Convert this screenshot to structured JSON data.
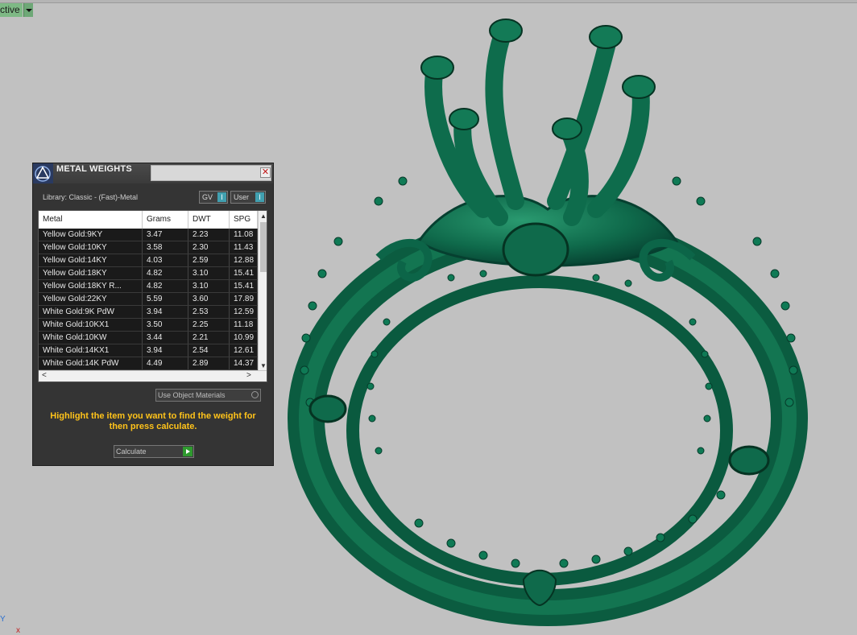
{
  "viewport": {
    "label": "ctive",
    "background": "#c1c1c1",
    "model_color": "#0f6a4b"
  },
  "dialog": {
    "title": "METAL WEIGHTS",
    "library": "Library: Classic - (Fast)-Metal",
    "toggle_gv": "GV",
    "toggle_user": "User",
    "toggle_indicator": "I",
    "columns": [
      "Metal",
      "Grams",
      "DWT",
      "SPG"
    ],
    "rows": [
      {
        "metal": "Yellow Gold:9KY",
        "grams": "3.47",
        "dwt": "2.23",
        "spg": "11.08"
      },
      {
        "metal": "Yellow Gold:10KY",
        "grams": "3.58",
        "dwt": "2.30",
        "spg": "11.43"
      },
      {
        "metal": "Yellow Gold:14KY",
        "grams": "4.03",
        "dwt": "2.59",
        "spg": "12.88"
      },
      {
        "metal": "Yellow Gold:18KY",
        "grams": "4.82",
        "dwt": "3.10",
        "spg": "15.41"
      },
      {
        "metal": "Yellow Gold:18KY R...",
        "grams": "4.82",
        "dwt": "3.10",
        "spg": "15.41"
      },
      {
        "metal": "Yellow Gold:22KY",
        "grams": "5.59",
        "dwt": "3.60",
        "spg": "17.89"
      },
      {
        "metal": "White Gold:9K PdW",
        "grams": "3.94",
        "dwt": "2.53",
        "spg": "12.59"
      },
      {
        "metal": "White Gold:10KX1",
        "grams": "3.50",
        "dwt": "2.25",
        "spg": "11.18"
      },
      {
        "metal": "White Gold:10KW",
        "grams": "3.44",
        "dwt": "2.21",
        "spg": "10.99"
      },
      {
        "metal": "White Gold:14KX1",
        "grams": "3.94",
        "dwt": "2.54",
        "spg": "12.61"
      },
      {
        "metal": "White Gold:14K PdW",
        "grams": "4.49",
        "dwt": "2.89",
        "spg": "14.37"
      }
    ],
    "use_object_materials": "Use Object Materials",
    "hint": "Highlight the item you want to find the weight for then press calculate.",
    "calculate": "Calculate"
  }
}
